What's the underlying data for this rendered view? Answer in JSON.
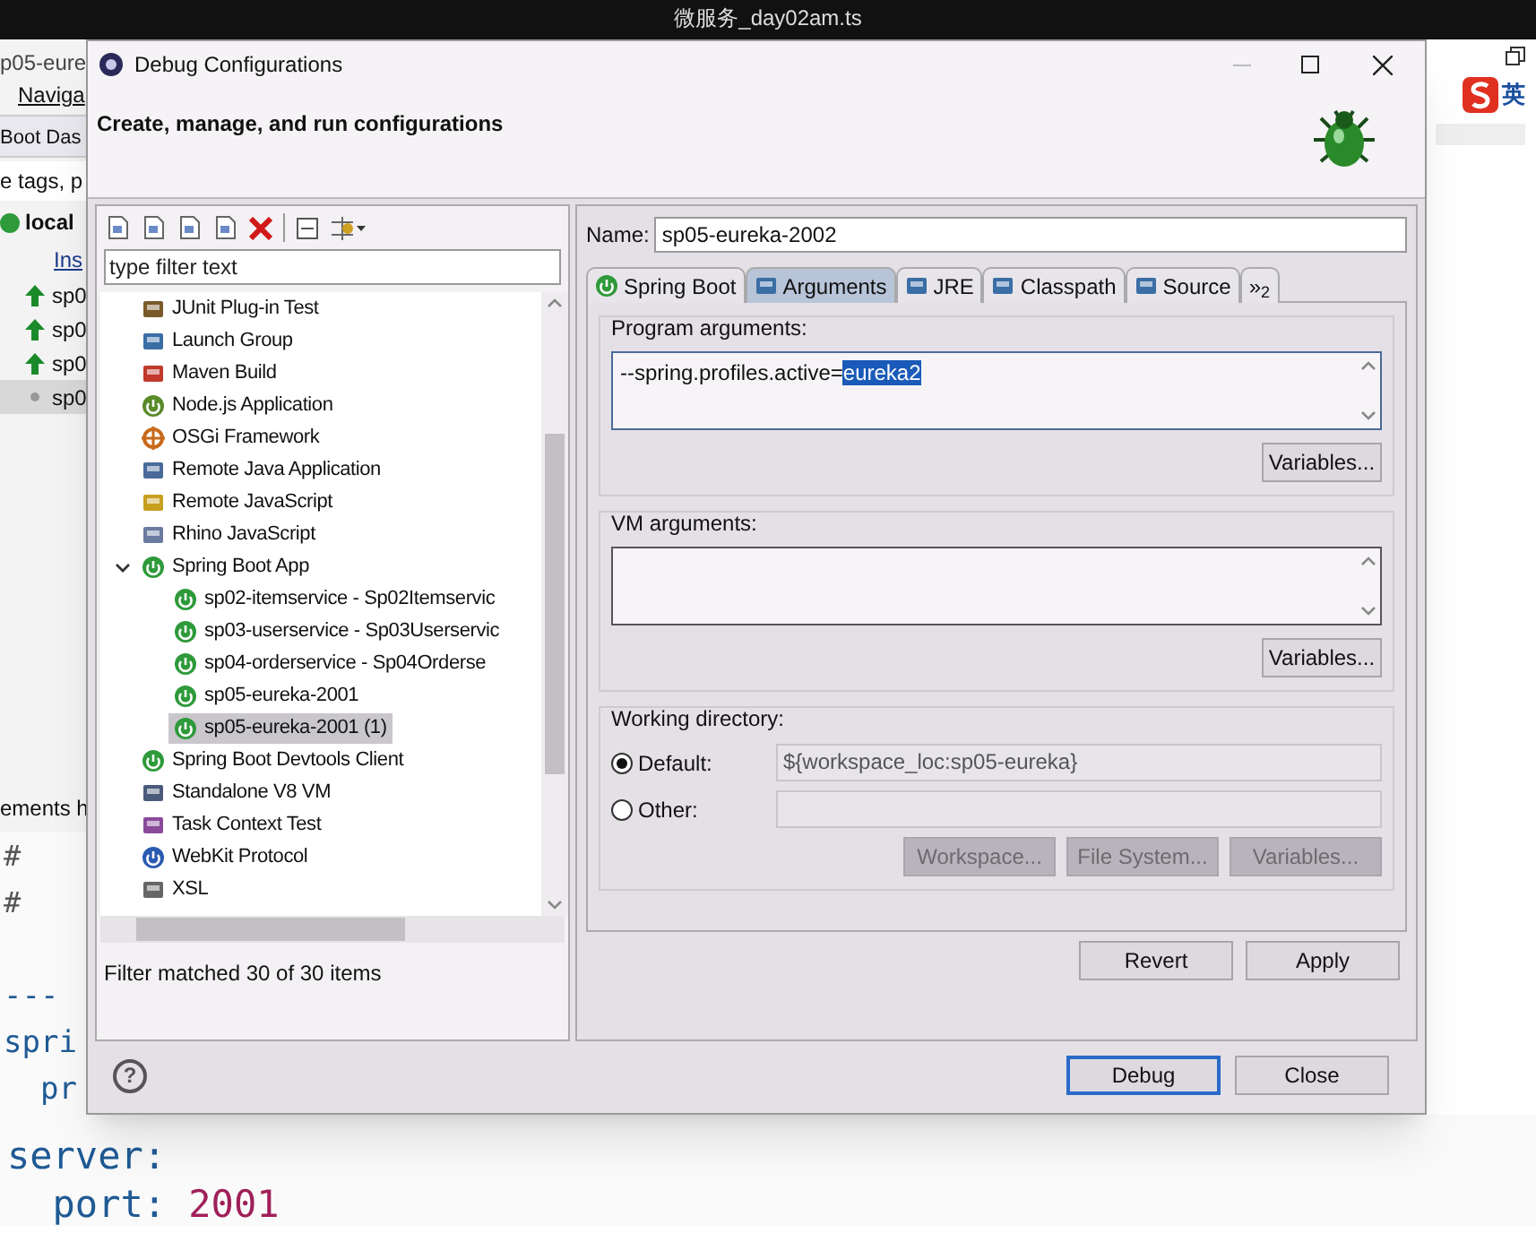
{
  "screen_title": "微服务_day02am.ts",
  "background_ide": {
    "editor_tab": "p05-eure",
    "menu_item": "Naviga",
    "view_title": "Boot Das",
    "filter_hint": "e tags, p",
    "local_label": "local",
    "install_link": "Ins",
    "apps": [
      {
        "label": "sp0",
        "running": true,
        "selected": false
      },
      {
        "label": "sp0",
        "running": true,
        "selected": false
      },
      {
        "label": "sp0",
        "running": true,
        "selected": false
      },
      {
        "label": "sp0",
        "running": false,
        "selected": true
      }
    ],
    "panel_tab": "ements h",
    "code_lines": [
      {
        "kind": "comment",
        "text": "#"
      },
      {
        "kind": "comment",
        "text": "#"
      },
      {
        "kind": "blank"
      },
      {
        "kind": "separator",
        "text": "---"
      },
      {
        "kind": "key",
        "text": "spri"
      },
      {
        "kind": "key",
        "text": "  pr"
      },
      {
        "kind": "blank"
      },
      {
        "kind": "key",
        "text": "server:"
      },
      {
        "kind": "pair",
        "text": "  port: ",
        "value": "2001"
      }
    ],
    "ime_label": "英"
  },
  "dialog": {
    "title": "Debug Configurations",
    "header": "Create, manage, and run configurations",
    "filter_placeholder": "type filter text",
    "tree": [
      {
        "kind": "junit",
        "label": "JUnit Plug-in Test",
        "selected": false
      },
      {
        "kind": "launch",
        "label": "Launch Group",
        "selected": false
      },
      {
        "kind": "maven",
        "label": "Maven Build",
        "selected": false
      },
      {
        "kind": "node",
        "label": "Node.js Application",
        "selected": false
      },
      {
        "kind": "osgi",
        "label": "OSGi Framework",
        "selected": false
      },
      {
        "kind": "remote",
        "label": "Remote Java Application",
        "selected": false
      },
      {
        "kind": "remotejs",
        "label": "Remote JavaScript",
        "selected": false
      },
      {
        "kind": "rhino",
        "label": "Rhino JavaScript",
        "selected": false
      },
      {
        "kind": "spring",
        "label": "Spring Boot App",
        "selected": false,
        "expanded": true,
        "children": [
          {
            "kind": "spring",
            "label": "sp02-itemservice - Sp02Itemservic",
            "selected": false
          },
          {
            "kind": "spring",
            "label": "sp03-userservice - Sp03Userservic",
            "selected": false
          },
          {
            "kind": "spring",
            "label": "sp04-orderservice - Sp04Orderse",
            "selected": false
          },
          {
            "kind": "spring",
            "label": "sp05-eureka-2001",
            "selected": false
          },
          {
            "kind": "spring",
            "label": "sp05-eureka-2001 (1)",
            "selected": true
          }
        ]
      },
      {
        "kind": "devtools",
        "label": "Spring Boot Devtools Client",
        "selected": false
      },
      {
        "kind": "v8",
        "label": "Standalone V8 VM",
        "selected": false
      },
      {
        "kind": "task",
        "label": "Task Context Test",
        "selected": false
      },
      {
        "kind": "webkit",
        "label": "WebKit Protocol",
        "selected": false
      },
      {
        "kind": "xsl",
        "label": "XSL",
        "selected": false
      }
    ],
    "filter_status": "Filter matched 30 of 30 items",
    "name_label": "Name:",
    "name_value": "sp05-eureka-2002",
    "tabs": [
      {
        "kind": "spring",
        "label": "Spring Boot",
        "selected": false
      },
      {
        "kind": "args",
        "label": "Arguments",
        "selected": true
      },
      {
        "kind": "jre",
        "label": "JRE",
        "selected": false
      },
      {
        "kind": "classpath",
        "label": "Classpath",
        "selected": false
      },
      {
        "kind": "source",
        "label": "Source",
        "selected": false
      },
      {
        "kind": "more",
        "label": "»$_{2}$",
        "selected": false
      }
    ],
    "program_arguments": {
      "label": "Program arguments:",
      "value": "--spring.profiles.active=",
      "selected_text": "eureka2",
      "button": "Variables..."
    },
    "vm_arguments": {
      "label": "VM arguments:",
      "button": "Variables..."
    },
    "working_directory": {
      "label": "Working directory:",
      "options": [
        {
          "label": "Default:",
          "selected": true,
          "value": "${workspace_loc:sp05-eureka}"
        },
        {
          "label": "Other:",
          "selected": false
        }
      ],
      "buttons": [
        {
          "label": "Workspace...",
          "disabled": true
        },
        {
          "label": "File System...",
          "disabled": true
        },
        {
          "label": "Variables...",
          "disabled": true
        }
      ]
    },
    "help_glyph": "?",
    "revert": "Revert",
    "apply": "Apply",
    "debug": "Debug",
    "close": "Close"
  }
}
